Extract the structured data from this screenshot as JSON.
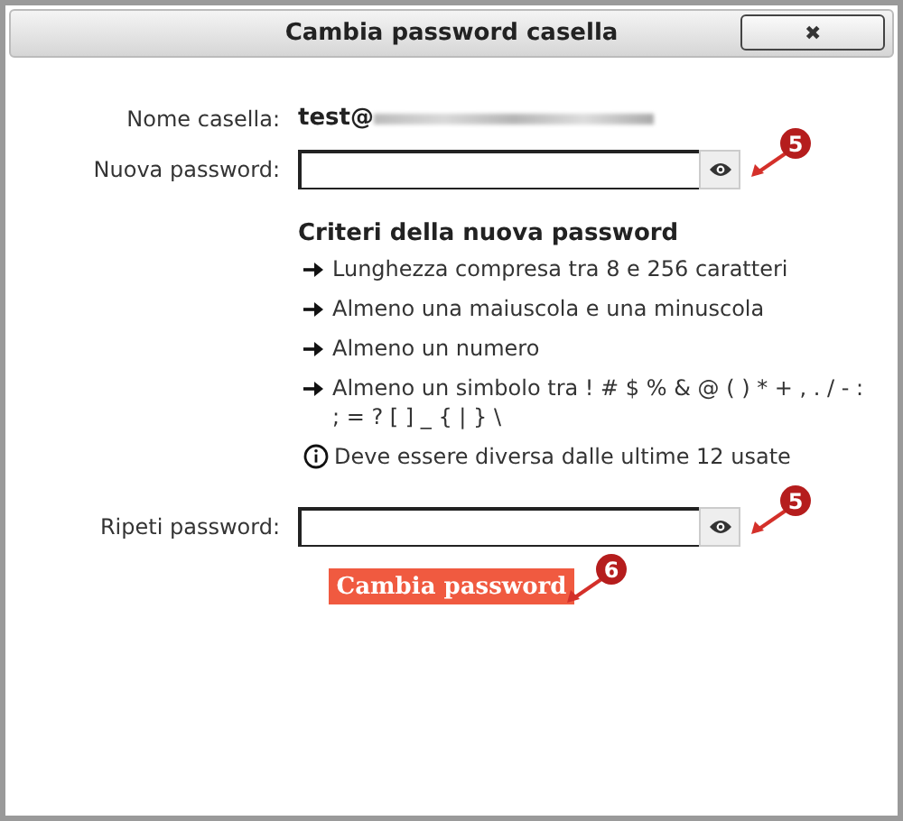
{
  "window": {
    "title": "Cambia password casella",
    "close": "✖"
  },
  "mailbox": {
    "label": "Nome casella:",
    "value": "test@"
  },
  "new_password": {
    "label": "Nuova password:",
    "callout": "5"
  },
  "criteria": {
    "title": "Criteri della nuova password",
    "items": [
      {
        "kind": "arrow",
        "text": "Lunghezza compresa tra 8 e 256 caratteri"
      },
      {
        "kind": "arrow",
        "text": "Almeno una maiuscola e una minuscola"
      },
      {
        "kind": "arrow",
        "text": "Almeno un numero"
      },
      {
        "kind": "arrow",
        "text": "Almeno un simbolo tra ! # $ % & @ ( ) * + , . / - : ; = ? [ ] _ { | } \\"
      },
      {
        "kind": "info",
        "text": "Deve essere diversa dalle ultime 12 usate"
      }
    ]
  },
  "repeat_password": {
    "label": "Ripeti password:",
    "callout": "5"
  },
  "submit": {
    "label": "Cambia password",
    "callout": "6"
  }
}
